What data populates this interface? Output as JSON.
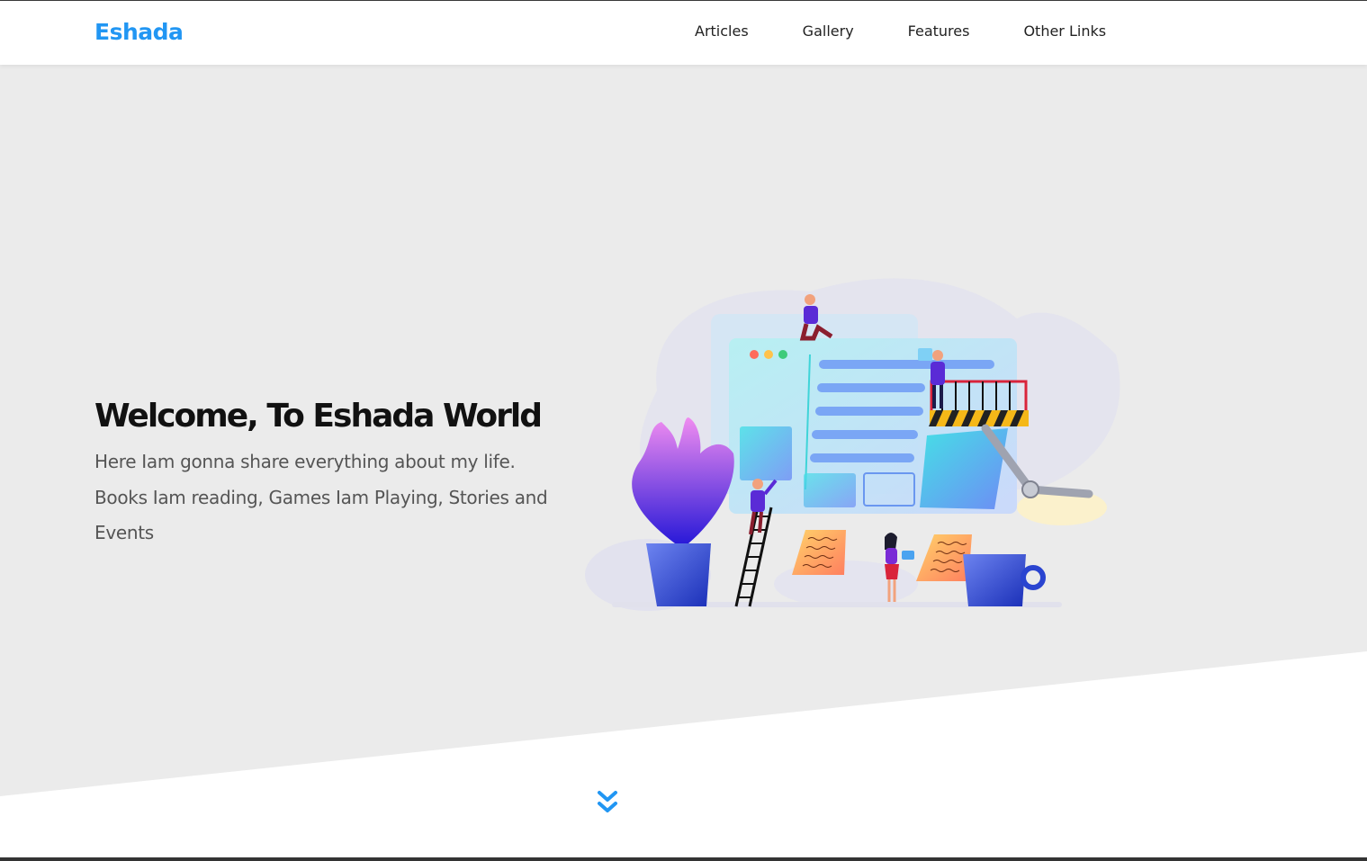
{
  "brand": {
    "name": "Eshada",
    "color": "#2196f3"
  },
  "nav": {
    "items": [
      {
        "label": "Articles"
      },
      {
        "label": "Gallery"
      },
      {
        "label": "Features"
      },
      {
        "label": "Other Links"
      }
    ]
  },
  "hero": {
    "title": "Welcome, To Eshada World",
    "text": "Here Iam gonna share everything about my life. Books Iam reading, Games Iam Playing, Stories and Events",
    "background": "#ebebeb",
    "illustration": "website-builders-illustration"
  },
  "scroll": {
    "icon": "double-chevron-down-icon",
    "color": "#2196f3"
  }
}
